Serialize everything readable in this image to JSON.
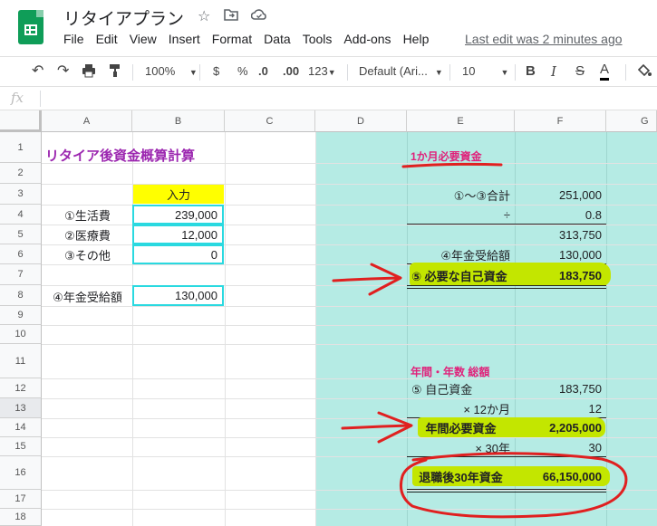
{
  "app": {
    "title": "リタイアプラン",
    "last_edit": "Last edit was 2 minutes ago"
  },
  "menu": [
    "File",
    "Edit",
    "View",
    "Insert",
    "Format",
    "Data",
    "Tools",
    "Add-ons",
    "Help"
  ],
  "toolbar": {
    "zoom": "100%",
    "currency": "$",
    "percent": "%",
    "dec_less": ".0",
    "dec_more": ".00",
    "more_formats": "123",
    "font": "Default (Ari...",
    "font_size": "10",
    "bold": "B",
    "italic": "I",
    "strike": "S",
    "text_color": "A"
  },
  "formula_bar": {
    "fx": "fx"
  },
  "columns": [
    "A",
    "B",
    "C",
    "D",
    "E",
    "F",
    "G"
  ],
  "rows": [
    "1",
    "2",
    "3",
    "4",
    "5",
    "6",
    "7",
    "8",
    "9",
    "10",
    "11",
    "12",
    "13",
    "14",
    "15",
    "16",
    "17",
    "18"
  ],
  "cells": {
    "a1": "リタイア後資金概算計算",
    "b3": "入力",
    "a4": "①生活費",
    "b4": "239,000",
    "a5": "②医療費",
    "b5": "12,000",
    "a6": "③その他",
    "b6": "0",
    "a8": "④年金受給額",
    "b8": "130,000",
    "e1": "1か月必要資金",
    "e3": "①～③合計",
    "f3": "251,000",
    "e4": "÷",
    "f4": "0.8",
    "f5": "313,750",
    "e6": "④年金受給額",
    "f6": "130,000",
    "e7": "⑤ 必要な自己資金",
    "f7": "183,750",
    "e11": "年間・年数 総額",
    "e12": "⑤ 自己資金",
    "f12": "183,750",
    "e13": "× 12か月",
    "f13": "12",
    "e14": "年間必要資金",
    "f14": "2,205,000",
    "e15": "× 30年",
    "f15": "30",
    "e16": "退職後30年資金",
    "f16": "66,150,000"
  },
  "colors": {
    "accent_green": "#0f9d58",
    "cyan_fill": "#b5ebe4",
    "highlight": "#c3e600",
    "input_header": "#ffff00",
    "annotation_red": "#e02020",
    "heading_pink": "#e0217a",
    "title_purple": "#9c27b0"
  }
}
